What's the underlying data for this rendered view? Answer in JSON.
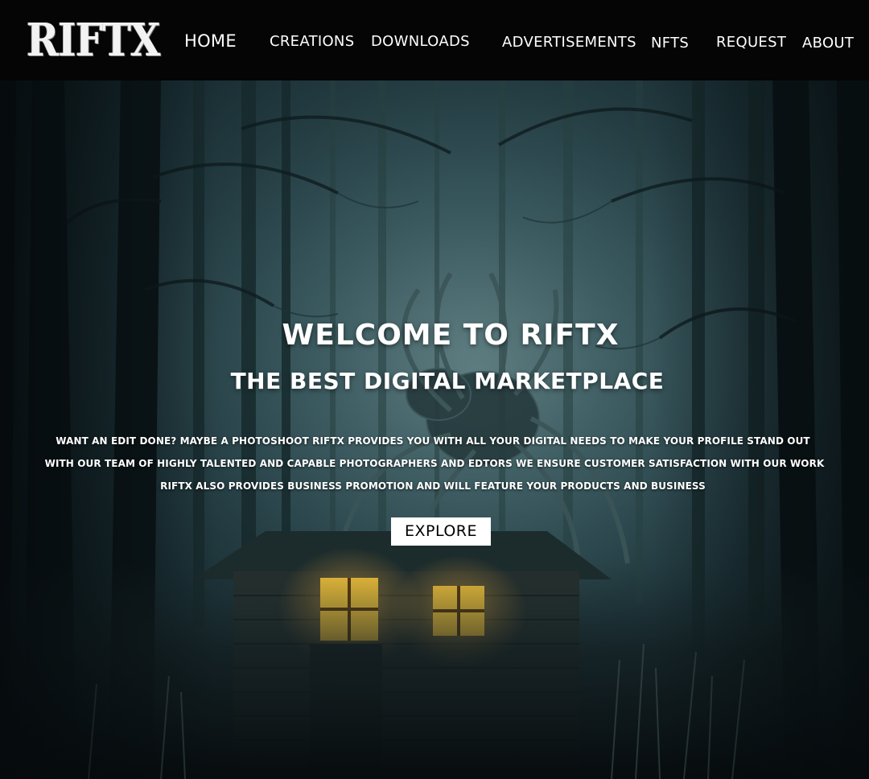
{
  "brand": {
    "logo_text": "RIFTX"
  },
  "nav": {
    "items": [
      {
        "label": "HOME"
      },
      {
        "label": "CREATIONS"
      },
      {
        "label": "DOWNLOADS"
      },
      {
        "label": "ADVERTISEMENTS"
      },
      {
        "label": "NFTS"
      },
      {
        "label": "REQUEST"
      },
      {
        "label": "ABOUT"
      }
    ]
  },
  "hero": {
    "title": "WELCOME TO RIFTX",
    "subtitle": "THE BEST DIGITAL MARKETPLACE",
    "lines": [
      "WANT AN EDIT DONE? MAYBE A PHOTOSHOOT RIFTX PROVIDES YOU WITH ALL YOUR DIGITAL NEEDS TO MAKE YOUR PROFILE STAND OUT",
      "WITH OUR TEAM OF HIGHLY TALENTED AND CAPABLE PHOTOGRAPHERS AND EDTORS WE ENSURE CUSTOMER SATISFACTION WITH OUR WORK",
      "RIFTX ALSO PROVIDES BUSINESS PROMOTION AND WILL FEATURE YOUR PRODUCTS AND BUSINESS"
    ],
    "button_label": "EXPLORE",
    "background_image": "dark-forest-cabin-spider"
  },
  "colors": {
    "navbar_bg": "#050505",
    "text": "#ffffff",
    "button_bg": "#ffffff",
    "button_text": "#000000",
    "window_glow": "#f2c23a"
  }
}
